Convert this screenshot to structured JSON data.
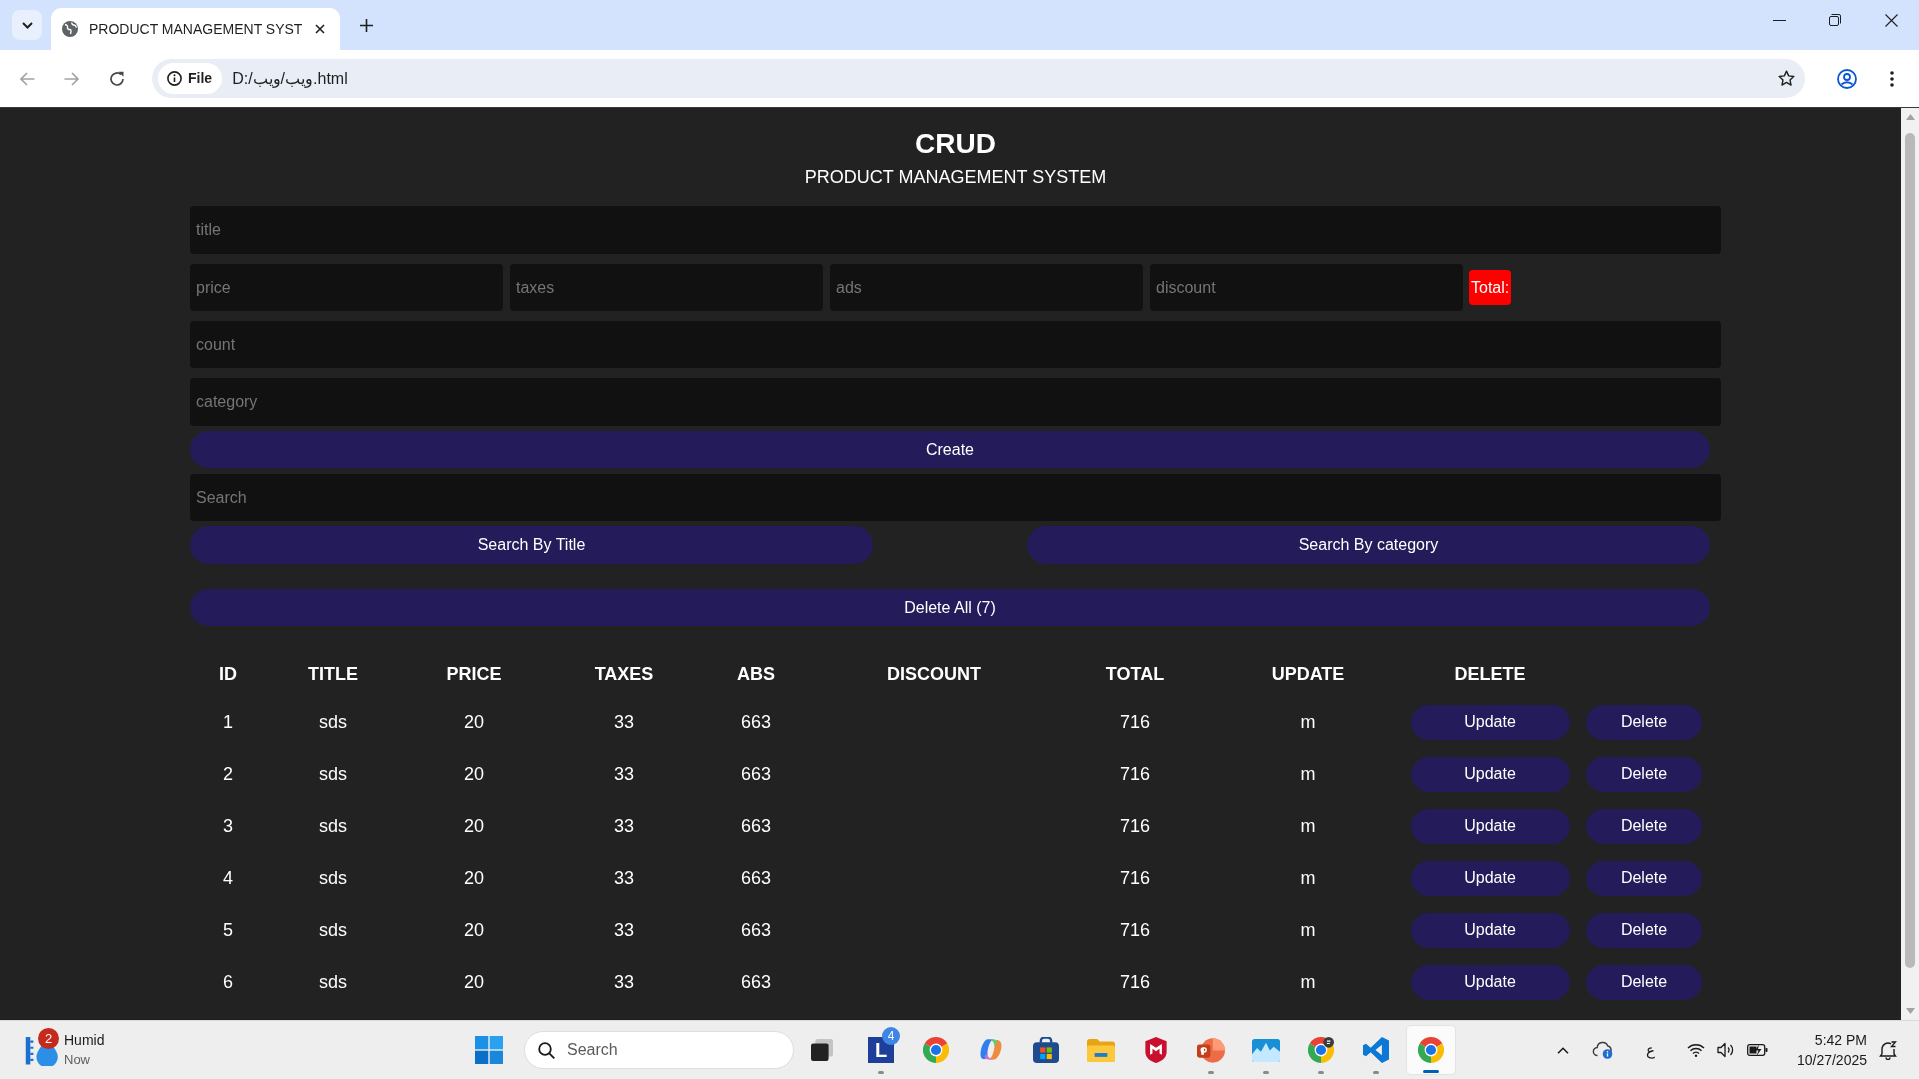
{
  "browser": {
    "tab": {
      "title": "PRODUCT MANAGEMENT SYST"
    },
    "address_bar": {
      "chip": "File",
      "url": "D:/ويب/ويب.html"
    }
  },
  "page": {
    "title": "CRUD",
    "subtitle": "PRODUCT MANAGEMENT SYSTEM",
    "form": {
      "title_field": {
        "placeholder": "title"
      },
      "price_fields": [
        {
          "placeholder": "price"
        },
        {
          "placeholder": "taxes"
        },
        {
          "placeholder": "ads"
        },
        {
          "placeholder": "discount"
        }
      ],
      "total": "Total:",
      "count_field": {
        "placeholder": "count"
      },
      "category_field": {
        "placeholder": "category"
      },
      "create_button": "Create",
      "search_field": {
        "placeholder": "Search"
      },
      "search_buttons": [
        "Search By Title",
        "Search By category"
      ],
      "delete_all_button": "Delete All (7)"
    },
    "table": {
      "columns": [
        "ID",
        "TITLE",
        "PRICE",
        "TAXES",
        "ABS",
        "DISCOUNT",
        "TOTAL",
        "UPDATE",
        "DELETE"
      ],
      "rows": [
        {
          "id": "1",
          "title": "sds",
          "price": "20",
          "taxes": "33",
          "ads": "663",
          "total": "716",
          "category": "m",
          "update_button": "Update",
          "delete_button": "Delete"
        },
        {
          "id": "2",
          "title": "sds",
          "price": "20",
          "taxes": "33",
          "ads": "663",
          "total": "716",
          "category": "m",
          "update_button": "Update",
          "delete_button": "Delete"
        },
        {
          "id": "3",
          "title": "sds",
          "price": "20",
          "taxes": "33",
          "ads": "663",
          "total": "716",
          "category": "m",
          "update_button": "Update",
          "delete_button": "Delete"
        },
        {
          "id": "4",
          "title": "sds",
          "price": "20",
          "taxes": "33",
          "ads": "663",
          "total": "716",
          "category": "m",
          "update_button": "Update",
          "delete_button": "Delete"
        },
        {
          "id": "5",
          "title": "sds",
          "price": "20",
          "taxes": "33",
          "ads": "663",
          "total": "716",
          "category": "m",
          "update_button": "Update",
          "delete_button": "Delete"
        },
        {
          "id": "6",
          "title": "sds",
          "price": "20",
          "taxes": "33",
          "ads": "663",
          "total": "716",
          "category": "m",
          "update_button": "Update",
          "delete_button": "Delete"
        }
      ]
    }
  },
  "taskbar": {
    "weather": {
      "badge": "2",
      "condition": "Humid",
      "time": "Now"
    },
    "search": {
      "label": "Search"
    },
    "apps": [
      {
        "kind": "letter-tile",
        "letter": "L",
        "badge": "4",
        "running": true,
        "selected": false
      },
      {
        "kind": "browser",
        "running": false,
        "selected": false
      },
      {
        "kind": "assistant",
        "running": false,
        "selected": false
      },
      {
        "kind": "store",
        "running": false,
        "selected": false
      },
      {
        "kind": "folder",
        "running": false,
        "selected": false
      },
      {
        "kind": "shield",
        "running": false,
        "selected": false
      },
      {
        "kind": "presentation",
        "running": true,
        "selected": false
      },
      {
        "kind": "monitor",
        "running": true,
        "selected": false
      },
      {
        "kind": "browser-profile",
        "running": true,
        "selected": false
      },
      {
        "kind": "code",
        "running": true,
        "selected": false
      },
      {
        "kind": "browser",
        "running": true,
        "selected": true
      }
    ],
    "tray": {
      "language": "ع"
    },
    "clock": {
      "time": "5:42 PM",
      "date": "10/27/2025"
    }
  }
}
